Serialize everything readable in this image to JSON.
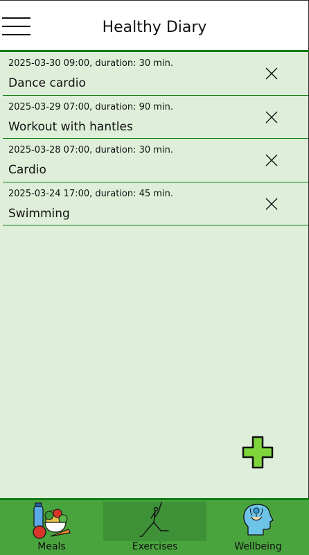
{
  "header": {
    "title": "Healthy Diary"
  },
  "entries": [
    {
      "meta": "2025-03-30 09:00, duration: 30 min.",
      "name": "Dance cardio"
    },
    {
      "meta": "2025-03-29 07:00, duration: 90 min.",
      "name": "Workout with hantles"
    },
    {
      "meta": "2025-03-28 07:00, duration: 30 min.",
      "name": "Cardio"
    },
    {
      "meta": "2025-03-24 17:00, duration: 45 min.",
      "name": "Swimming"
    }
  ],
  "nav": {
    "items": [
      {
        "label": "Meals",
        "icon": "meals-icon"
      },
      {
        "label": "Exercises",
        "icon": "exercise-icon",
        "active": true
      },
      {
        "label": "Wellbeing",
        "icon": "wellbeing-icon"
      }
    ]
  },
  "colors": {
    "accent": "#0b7d12",
    "content_bg": "#dfeed9",
    "nav_bg": "#4aa43e",
    "nav_active": "#3f9137",
    "fab": "#7ed63a"
  }
}
